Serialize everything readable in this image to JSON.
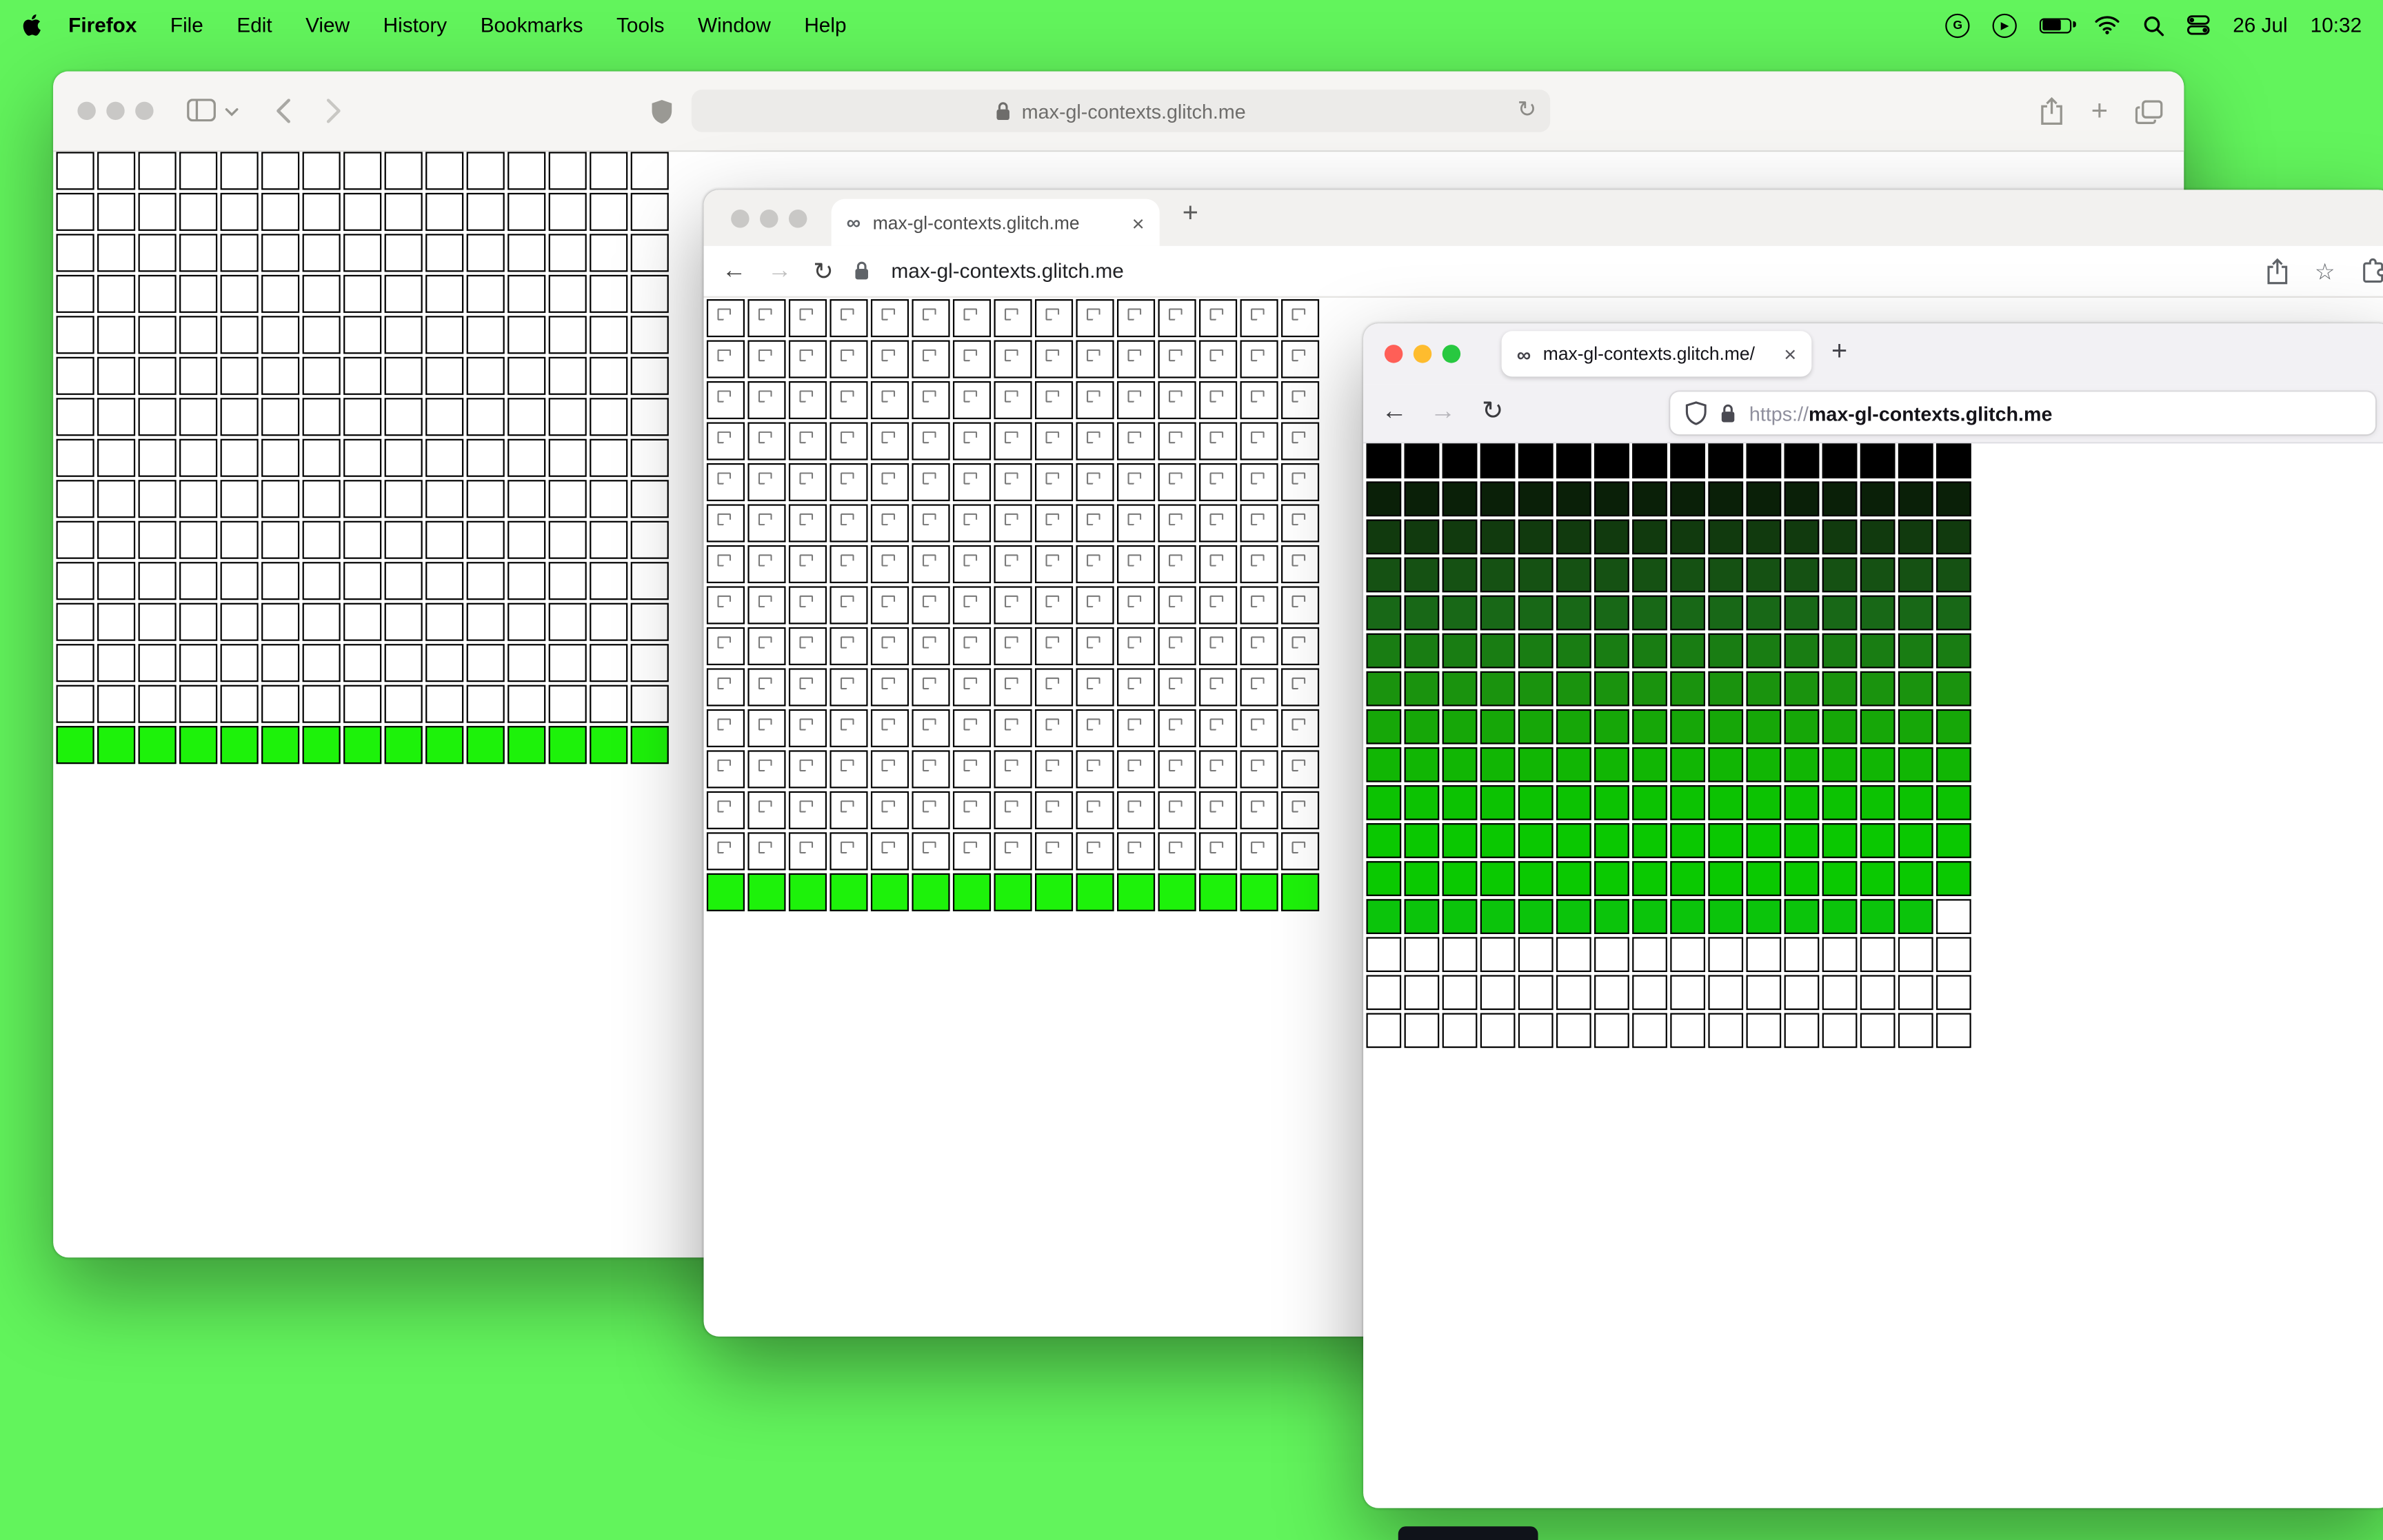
{
  "desktop": {
    "background_color": "#62f45c"
  },
  "menu_bar": {
    "app_name": "Firefox",
    "menus": [
      "File",
      "Edit",
      "View",
      "History",
      "Bookmarks",
      "Tools",
      "Window",
      "Help"
    ],
    "status_date": "26 Jul",
    "status_time": "10:32"
  },
  "icons": {
    "back_arrow": "←",
    "forward_arrow": "→",
    "reload": "↻",
    "plus": "+",
    "close": "×",
    "star": "☆",
    "infinity": "∞",
    "play": "▶",
    "grammarly": "G"
  },
  "safari_window": {
    "url_host": "max-gl-contexts.glitch.me",
    "grid": {
      "cols": 15,
      "rows": 15,
      "green_rows": [
        14
      ],
      "cell_color": "#ffffff",
      "green_color": "#1df20a",
      "border_color": "#000000"
    }
  },
  "chrome_window": {
    "tab_title": "max-gl-contexts.glitch.me",
    "url_host": "max-gl-contexts.glitch.me",
    "grid": {
      "cols": 15,
      "rows": 15,
      "green_rows": [
        14
      ],
      "cell_color": "#ffffff",
      "green_color": "#1df20a",
      "border_color": "#000000",
      "broken_icon": true
    }
  },
  "firefox_window": {
    "tab_title": "max-gl-contexts.glitch.me/",
    "url_scheme": "https://",
    "url_host": "max-gl-contexts.glitch.me",
    "grid": {
      "cols": 16,
      "rows": 16,
      "border_color": "#000000",
      "row_colors": [
        "#000000",
        "#0a2008",
        "#113a0e",
        "#155113",
        "#186817",
        "#197d13",
        "#1a930e",
        "#16a708",
        "#11b604",
        "#0cc202",
        "#0ac801",
        "#0ac901",
        "#0bc40b",
        "#ffffff",
        "#ffffff",
        "#ffffff"
      ],
      "white_cells": [
        [
          12,
          15
        ]
      ]
    }
  }
}
